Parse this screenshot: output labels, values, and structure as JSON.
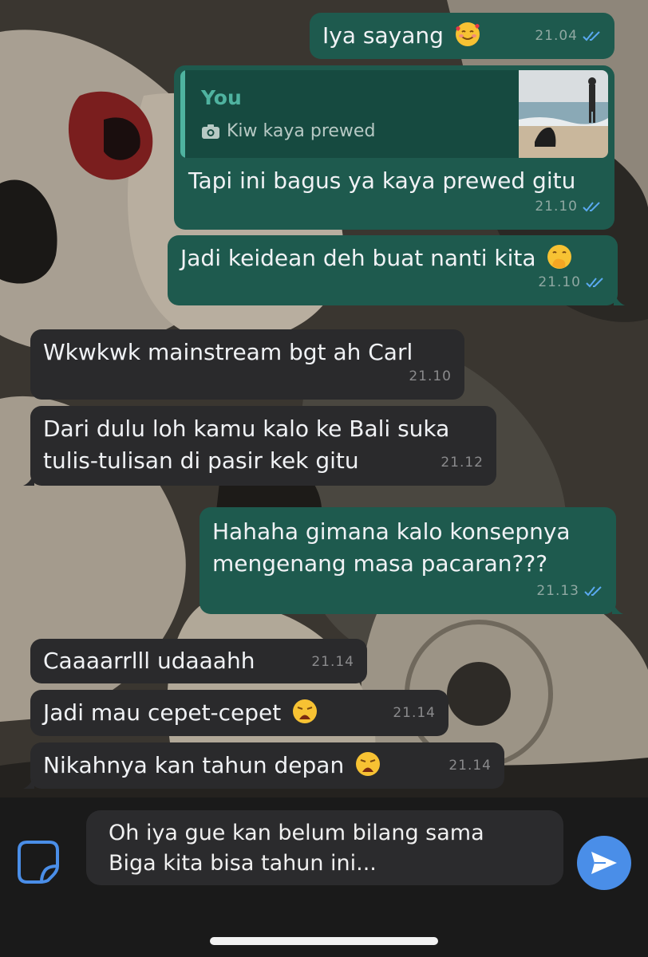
{
  "messages": [
    {
      "text": "Iya sayang",
      "emoji": "smiling-face-with-hearts",
      "time": "21.04",
      "direction": "out",
      "status": "read"
    },
    {
      "reply_to": {
        "author": "You",
        "media_label": "Kiw kaya prewed",
        "media_icon": "camera-icon"
      },
      "text": "Tapi ini bagus ya kaya prewed gitu",
      "time": "21.10",
      "direction": "out",
      "status": "read"
    },
    {
      "text": "Jadi keidean deh buat nanti kita",
      "emoji": "face-with-hand-over-mouth",
      "time": "21.10",
      "direction": "out",
      "status": "read"
    },
    {
      "text": "Wkwkwk mainstream bgt ah Carl",
      "time": "21.10",
      "direction": "in"
    },
    {
      "lines": [
        "Dari dulu loh kamu kalo ke Bali suka",
        "tulis-tulisan di pasir kek gitu"
      ],
      "time": "21.12",
      "direction": "in"
    },
    {
      "lines": [
        "Hahaha gimana kalo konsepnya",
        "mengenang masa pacaran???"
      ],
      "time": "21.13",
      "direction": "out",
      "status": "read"
    },
    {
      "text": "Caaaarrlll udaaahh",
      "time": "21.14",
      "direction": "in"
    },
    {
      "text": "Jadi mau cepet-cepet",
      "emoji": "weary-face",
      "time": "21.14",
      "direction": "in"
    },
    {
      "text": "Nikahnya kan tahun depan",
      "emoji": "weary-face",
      "time": "21.14",
      "direction": "in"
    }
  ],
  "composer": {
    "text": "Oh iya gue kan belum bilang sama\nBiga kita bisa tahun ini...",
    "sticker_icon": "sticker-icon",
    "send_icon": "send-icon"
  },
  "colors": {
    "outgoing_bubble": "#1e5a4e",
    "incoming_bubble": "#2a2a2c",
    "read_ticks": "#5aa9f0",
    "send_button": "#4a8ee8",
    "reply_author": "#4fb3a0"
  }
}
